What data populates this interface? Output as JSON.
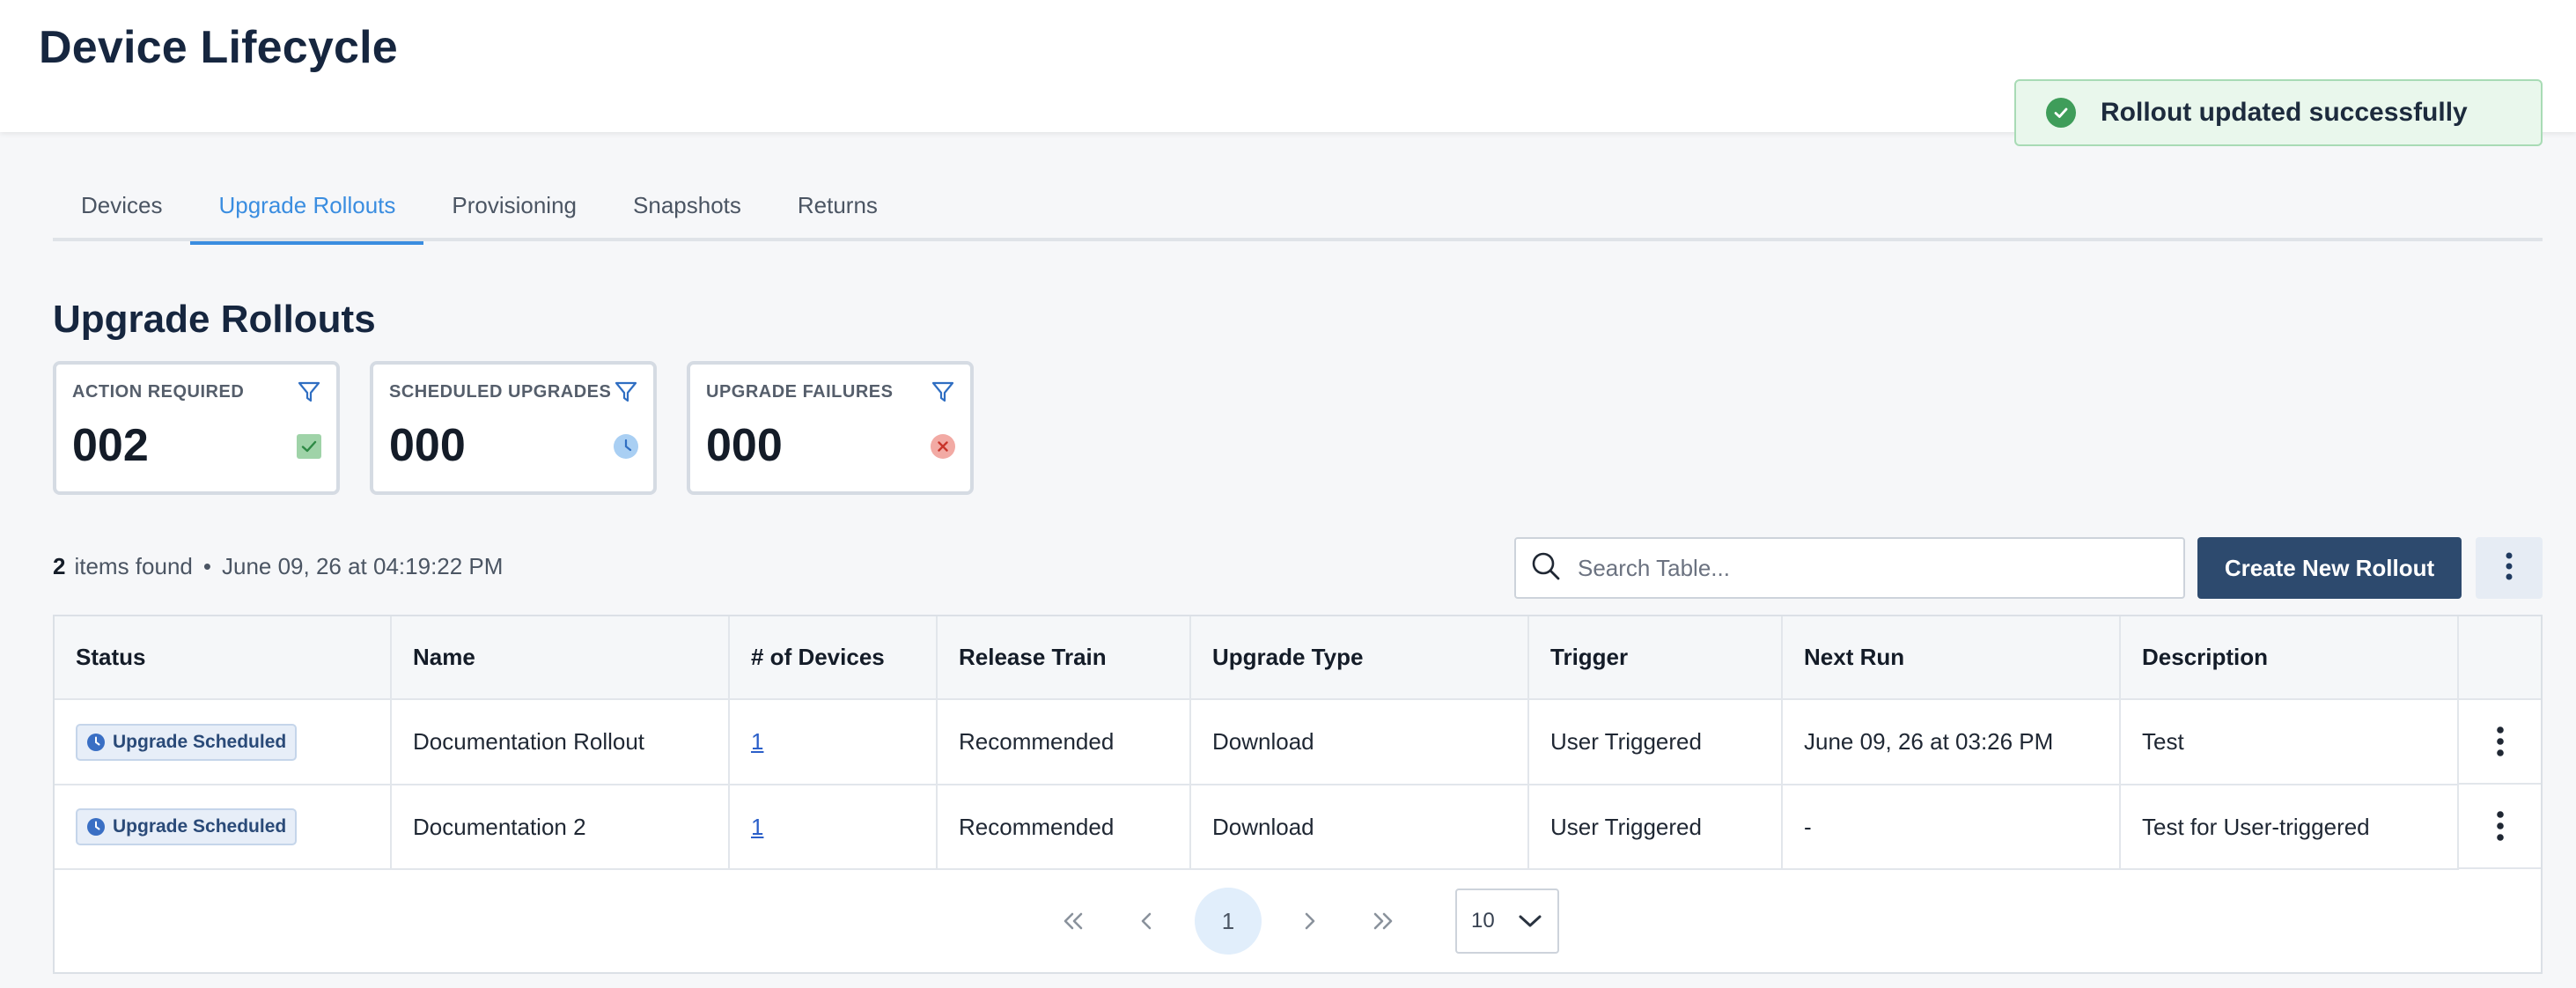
{
  "header": {
    "title": "Device Lifecycle"
  },
  "toast": {
    "message": "Rollout updated successfully",
    "color": "#3f9d5a"
  },
  "tabs": [
    {
      "label": "Devices",
      "active": false
    },
    {
      "label": "Upgrade Rollouts",
      "active": true
    },
    {
      "label": "Provisioning",
      "active": false
    },
    {
      "label": "Snapshots",
      "active": false
    },
    {
      "label": "Returns",
      "active": false
    }
  ],
  "section": {
    "title": "Upgrade Rollouts"
  },
  "summary_cards": [
    {
      "label": "ACTION REQUIRED",
      "value": "002",
      "status_icon": "check-icon",
      "status_color": "#7cc08a"
    },
    {
      "label": "SCHEDULED UPGRADES",
      "value": "000",
      "status_icon": "clock-icon",
      "status_color": "#8ec0ee"
    },
    {
      "label": "UPGRADE FAILURES",
      "value": "000",
      "status_icon": "x-circle-icon",
      "status_color": "#ee9a94"
    }
  ],
  "results": {
    "count": "2",
    "suffix": "items found",
    "separator": "•",
    "timestamp": "June 09, 26 at 04:19:22 PM"
  },
  "search": {
    "placeholder": "Search Table..."
  },
  "actions": {
    "create_label": "Create New Rollout"
  },
  "table": {
    "columns": [
      "Status",
      "Name",
      "# of Devices",
      "Release Train",
      "Upgrade Type",
      "Trigger",
      "Next Run",
      "Description",
      ""
    ],
    "rows": [
      {
        "status": "Upgrade Scheduled",
        "name": "Documentation Rollout",
        "devices": "1",
        "release_train": "Recommended",
        "upgrade_type": "Download",
        "trigger": "User Triggered",
        "next_run": "June 09, 26 at 03:26 PM",
        "description": "Test"
      },
      {
        "status": "Upgrade Scheduled",
        "name": "Documentation 2",
        "devices": "1",
        "release_train": "Recommended",
        "upgrade_type": "Download",
        "trigger": "User Triggered",
        "next_run": "-",
        "description": "Test for User-triggered"
      }
    ]
  },
  "pagination": {
    "current_page": "1",
    "page_size": "10"
  },
  "colors": {
    "accent": "#3a8de0",
    "primary_button": "#2d4a6e",
    "title": "#16263f"
  }
}
